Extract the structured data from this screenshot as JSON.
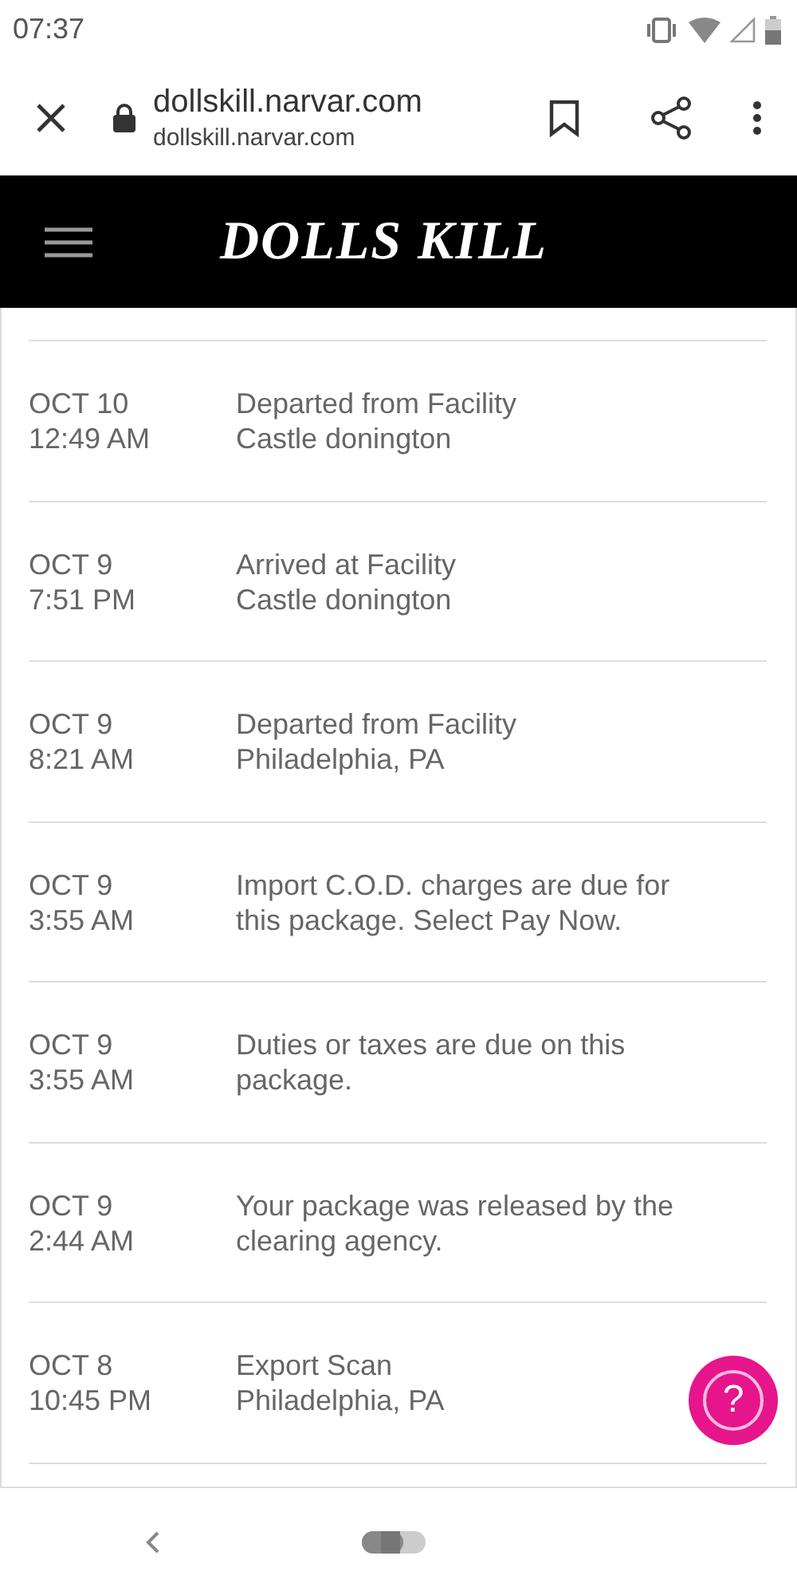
{
  "status_bar": {
    "time": "07:37"
  },
  "browser": {
    "title": "dollskill.narvar.com",
    "url": "dollskill.narvar.com"
  },
  "header": {
    "logo": "DOLLS KILL"
  },
  "events": [
    {
      "date": "OCT 10",
      "time": "12:49 AM",
      "lines": [
        "Departed from Facility",
        "Castle donington"
      ]
    },
    {
      "date": "OCT 9",
      "time": "7:51 PM",
      "lines": [
        "Arrived at Facility",
        "Castle donington"
      ]
    },
    {
      "date": "OCT 9",
      "time": "8:21 AM",
      "lines": [
        "Departed from Facility",
        "Philadelphia, PA"
      ]
    },
    {
      "date": "OCT 9",
      "time": "3:55 AM",
      "lines": [
        "Import C.O.D. charges are due for this package. Select Pay Now."
      ]
    },
    {
      "date": "OCT 9",
      "time": "3:55 AM",
      "lines": [
        "Duties or taxes are due on this package."
      ]
    },
    {
      "date": "OCT 9",
      "time": "2:44 AM",
      "lines": [
        "Your package was released by the clearing agency."
      ]
    },
    {
      "date": "OCT 8",
      "time": "10:45 PM",
      "lines": [
        "Export Scan",
        "Philadelphia, PA"
      ]
    }
  ],
  "help_button": {
    "label": "?"
  }
}
